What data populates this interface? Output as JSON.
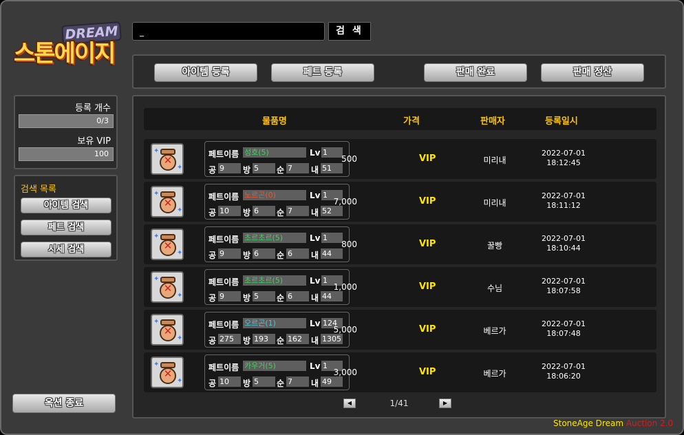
{
  "logo": {
    "badge": "DREAM",
    "title": "스톤에이지"
  },
  "search": {
    "value": "_",
    "button": "검 색"
  },
  "toolbar": {
    "item_register": "아이템 등록",
    "pet_register": "페트 등록",
    "sale_complete": "판매 완료",
    "sale_settle": "판매 정산"
  },
  "status": {
    "reg_count_label": "등록 개수",
    "reg_count_value": "0/3",
    "vip_label": "보유 VIP",
    "vip_value": "100"
  },
  "search_menu": {
    "title": "검색 목록",
    "item_search": "아이템 검색",
    "pet_search": "페트 검색",
    "price_search": "시세 검색"
  },
  "exit_button": "옥션 종료",
  "table": {
    "headers": {
      "item": "물품명",
      "price": "가격",
      "seller": "판매자",
      "date": "등록일시"
    },
    "field_labels": {
      "name": "페트이름",
      "lv": "Lv",
      "atk": "공",
      "def": "방",
      "agi": "순",
      "hp": "내"
    },
    "rows": [
      {
        "name": "성호(5)",
        "name_color": "#40d060",
        "lv": "1",
        "atk": "9",
        "def": "5",
        "agi": "7",
        "hp": "51",
        "price": "500",
        "currency": "VIP",
        "seller": "미리내",
        "date": "2022-07-01",
        "time": "18:12:45"
      },
      {
        "name": "노르곤(0)",
        "name_color": "#ff5020",
        "lv": "1",
        "atk": "10",
        "def": "6",
        "agi": "7",
        "hp": "52",
        "price": "7,000",
        "currency": "VIP",
        "seller": "미리내",
        "date": "2022-07-01",
        "time": "18:11:12"
      },
      {
        "name": "초르초르(5)",
        "name_color": "#40d060",
        "lv": "1",
        "atk": "9",
        "def": "6",
        "agi": "6",
        "hp": "44",
        "price": "800",
        "currency": "VIP",
        "seller": "꿀빵",
        "date": "2022-07-01",
        "time": "18:10:44"
      },
      {
        "name": "초르초르(5)",
        "name_color": "#40d060",
        "lv": "1",
        "atk": "9",
        "def": "5",
        "agi": "6",
        "hp": "44",
        "price": "1,000",
        "currency": "VIP",
        "seller": "수님",
        "date": "2022-07-01",
        "time": "18:07:58"
      },
      {
        "name": "오르곤(1)",
        "name_color": "#40c8e0",
        "lv": "124",
        "atk": "275",
        "def": "193",
        "agi": "162",
        "hp": "1305",
        "price": "5,000",
        "currency": "VIP",
        "seller": "베르가",
        "date": "2022-07-01",
        "time": "18:07:48"
      },
      {
        "name": "카우거(5)",
        "name_color": "#40d060",
        "lv": "1",
        "atk": "10",
        "def": "5",
        "agi": "7",
        "hp": "49",
        "price": "3,000",
        "currency": "VIP",
        "seller": "베르가",
        "date": "2022-07-01",
        "time": "18:06:20"
      }
    ]
  },
  "pager": {
    "prev": "◀",
    "next": "▶",
    "page": "1/41"
  },
  "brand": {
    "name": "StoneAge Dream",
    "version": "Auction 2.0"
  }
}
